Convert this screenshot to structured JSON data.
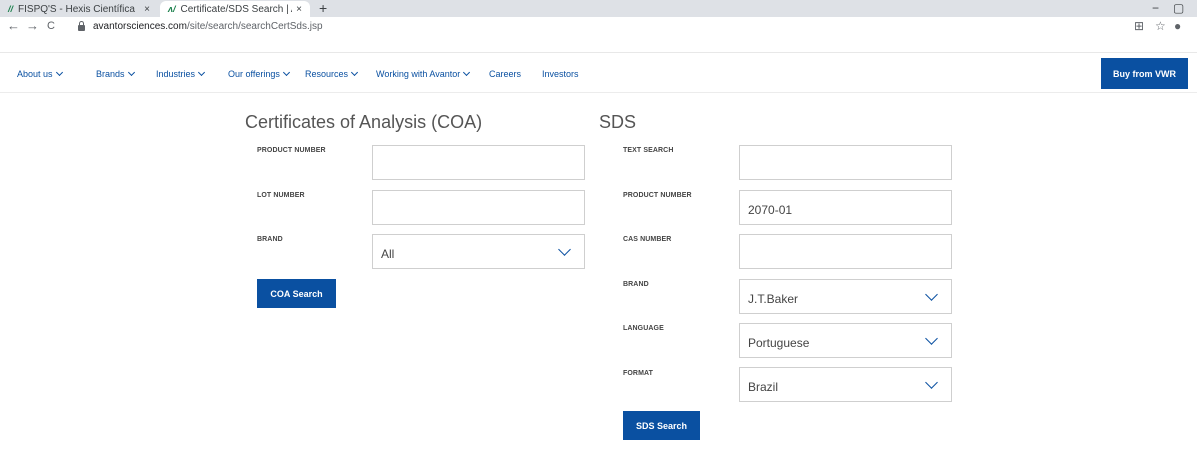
{
  "browser": {
    "tabs": [
      {
        "title": "FISPQ'S - Hexis Científica",
        "favicon": "hexis-favicon",
        "active": false
      },
      {
        "title": "Certificate/SDS Search | Avantor",
        "favicon": "avantor-favicon",
        "active": true
      }
    ],
    "favicon_glyphs": {
      "hexis": "//",
      "avantor": "ʌ/"
    },
    "url_host": "avantorsciences.com",
    "url_path": "/site/search/searchCertSds.jsp",
    "icons": {
      "back": "←",
      "forward": "→",
      "reload": "C",
      "close": "×",
      "new_tab": "+",
      "minimize": "−",
      "restore": "▢",
      "translate": "⊞",
      "star": "☆",
      "profile": "●"
    }
  },
  "site_nav": {
    "items": [
      {
        "label": "About us",
        "dropdown": true
      },
      {
        "label": "Brands",
        "dropdown": true
      },
      {
        "label": "Industries",
        "dropdown": true
      },
      {
        "label": "Our offerings",
        "dropdown": true
      },
      {
        "label": "Resources",
        "dropdown": true
      },
      {
        "label": "Working with Avantor",
        "dropdown": true
      },
      {
        "label": "Careers",
        "dropdown": false
      },
      {
        "label": "Investors",
        "dropdown": false
      }
    ],
    "buy_button": "Buy from VWR"
  },
  "coa": {
    "title": "Certificates of Analysis (COA)",
    "product_number": {
      "label": "PRODUCT NUMBER",
      "value": ""
    },
    "lot_number": {
      "label": "LOT NUMBER",
      "value": ""
    },
    "brand": {
      "label": "BRAND",
      "value": "All"
    },
    "search_button": "COA Search"
  },
  "sds": {
    "title": "SDS",
    "text_search": {
      "label": "TEXT SEARCH",
      "value": ""
    },
    "product_number": {
      "label": "PRODUCT NUMBER",
      "value": "2070-01"
    },
    "cas_number": {
      "label": "CAS NUMBER",
      "value": ""
    },
    "brand": {
      "label": "BRAND",
      "value": "J.T.Baker"
    },
    "language": {
      "label": "LANGUAGE",
      "value": "Portuguese"
    },
    "format": {
      "label": "FORMAT",
      "value": "Brazil"
    },
    "search_button": "SDS Search"
  },
  "colors": {
    "accent": "#0a50a1",
    "tabstrip": "#dee1e6",
    "field_border": "#cfcfcf"
  }
}
